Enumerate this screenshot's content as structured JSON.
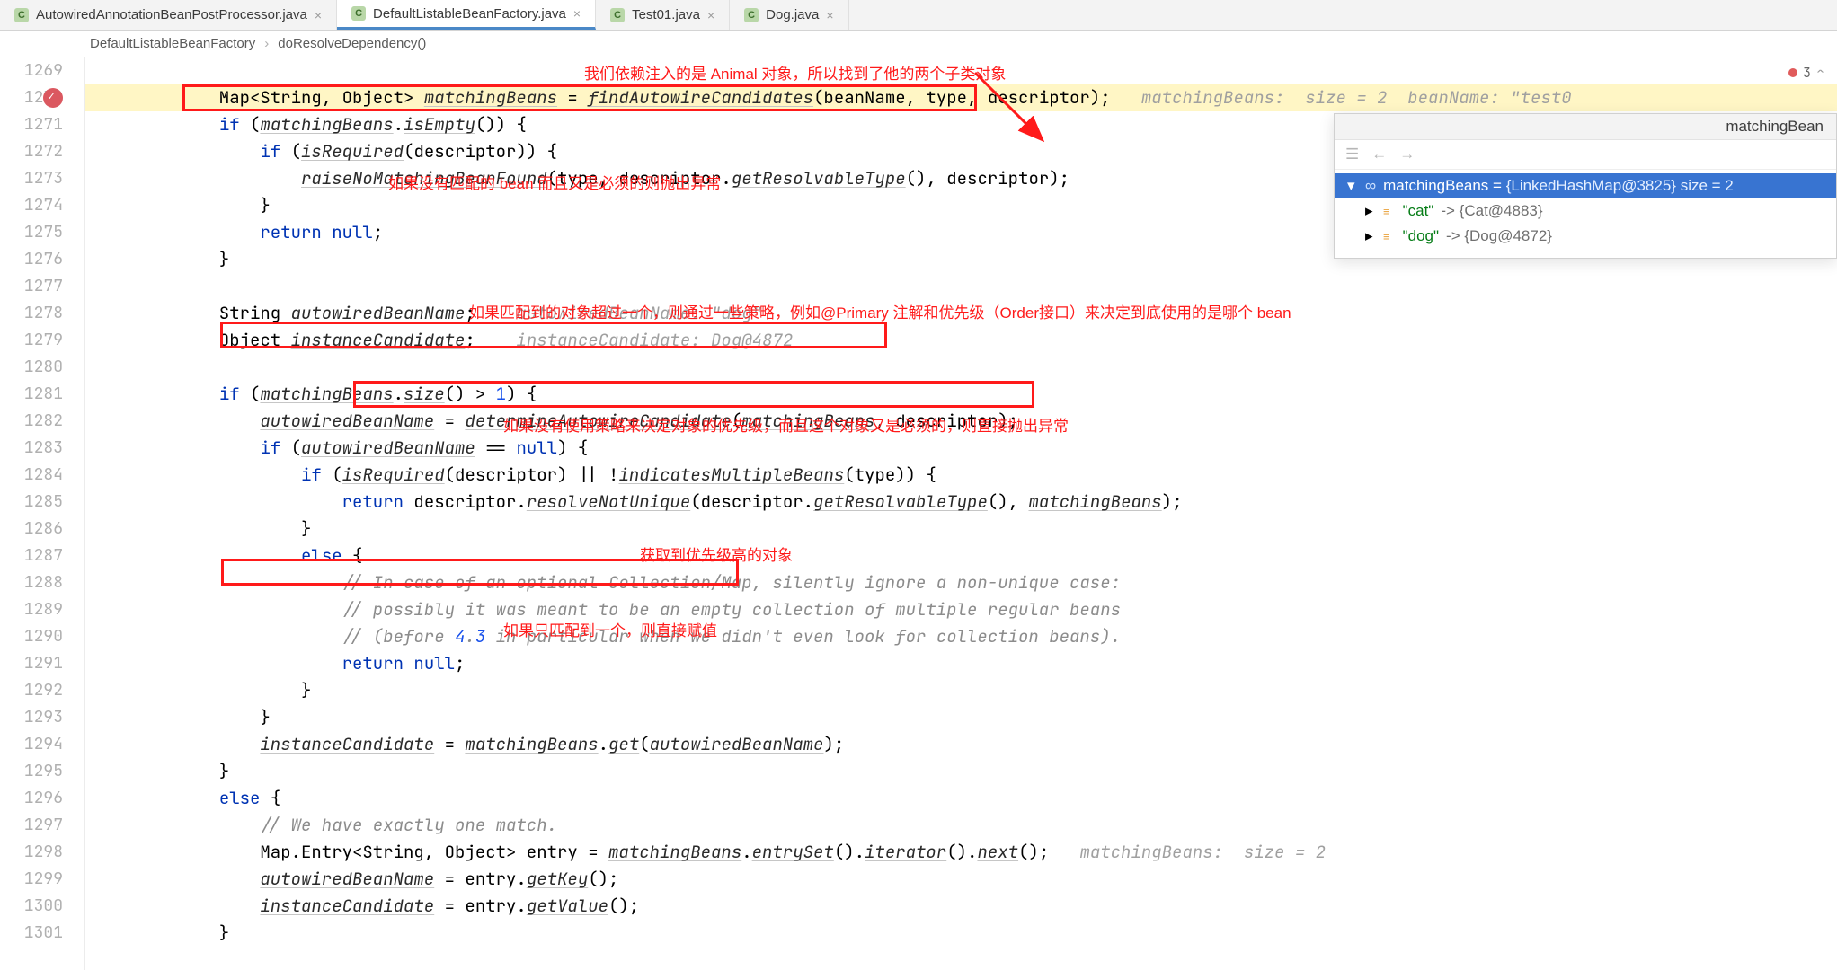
{
  "tabs": [
    {
      "label": "AutowiredAnnotationBeanPostProcessor.java",
      "icon": "C",
      "closable": true,
      "active": false
    },
    {
      "label": "DefaultListableBeanFactory.java",
      "icon": "C",
      "closable": true,
      "active": true
    },
    {
      "label": "Test01.java",
      "icon": "C",
      "closable": true,
      "active": false
    },
    {
      "label": "Dog.java",
      "icon": "C",
      "closable": true,
      "active": false
    }
  ],
  "breadcrumb": {
    "class": "DefaultListableBeanFactory",
    "method": "doResolveDependency()"
  },
  "error_badge": {
    "count": 3
  },
  "gutter": {
    "first_line": 1269,
    "last_line": 1301,
    "breakpoint_line": 1270
  },
  "code_base_indent": "            ",
  "code": {
    "l1269": "",
    "l1270": {
      "text": "Map<String, Object> matchingBeans = findAutowireCandidates(beanName, type, descriptor);",
      "hint": "matchingBeans:  size = 2  beanName: \"test0"
    },
    "l1271": "if (matchingBeans.isEmpty()) {",
    "l1272": "    if (isRequired(descriptor)) {",
    "l1273": "        raiseNoMatchingBeanFound(type, descriptor.getResolvableType(), descriptor);",
    "l1274": "    }",
    "l1275": "    return null;",
    "l1276": "}",
    "l1277": "",
    "l1278": {
      "text": "String autowiredBeanName;",
      "hint": " autowiredBeanName: \"dog\""
    },
    "l1279": {
      "text": "Object instanceCandidate;",
      "hint": " instanceCandidate: Dog@4872"
    },
    "l1280": "",
    "l1281": "if (matchingBeans.size() > 1) {",
    "l1282": "    autowiredBeanName = determineAutowireCandidate(matchingBeans, descriptor);",
    "l1283": "    if (autowiredBeanName == null) {",
    "l1284": "        if (isRequired(descriptor) || !indicatesMultipleBeans(type)) {",
    "l1285": "            return descriptor.resolveNotUnique(descriptor.getResolvableType(), matchingBeans);",
    "l1286": "        }",
    "l1287": "        else {",
    "l1288": "            // In case of an optional Collection/Map, silently ignore a non-unique case:",
    "l1289": "            // possibly it was meant to be an empty collection of multiple regular beans",
    "l1290": "            // (before 4.3 in particular when we didn't even look for collection beans).",
    "l1291": "            return null;",
    "l1292": "        }",
    "l1293": "    }",
    "l1294": "    instanceCandidate = matchingBeans.get(autowiredBeanName);",
    "l1295": "}",
    "l1296": "else {",
    "l1297": "    // We have exactly one match.",
    "l1298": {
      "text": "    Map.Entry<String, Object> entry = matchingBeans.entrySet().iterator().next();",
      "hint": "matchingBeans:  size = 2"
    },
    "l1299": "    autowiredBeanName = entry.getKey();",
    "l1300": "    instanceCandidate = entry.getValue();",
    "l1301": "}"
  },
  "annotations": {
    "a1": "我们依赖注入的是 Animal 对象，所以找到了他的两个子类对象",
    "a2": "如果没有匹配的 bean 而且又是必须的则抛出异常",
    "a3": "如果匹配到的对象超过一个，则通过一些策略，例如@Primary 注解和优先级（Order接口）来决定到底使用的是哪个 bean",
    "a4": "如果没有使用策略来决定对象的优先级，而且这个对象又是必须的，则直接抛出异常",
    "a5": "获取到优先级高的对象",
    "a6": "如果只匹配到一个，则直接赋值"
  },
  "popup": {
    "title": "matchingBean",
    "toolbar": {
      "back": "←",
      "forward": "→"
    },
    "root": {
      "name": "matchingBeans",
      "value": "{LinkedHashMap@3825}  size = 2"
    },
    "children": [
      {
        "key": "\"cat\"",
        "value": "{Cat@4883}"
      },
      {
        "key": "\"dog\"",
        "value": "{Dog@4872}"
      }
    ]
  }
}
